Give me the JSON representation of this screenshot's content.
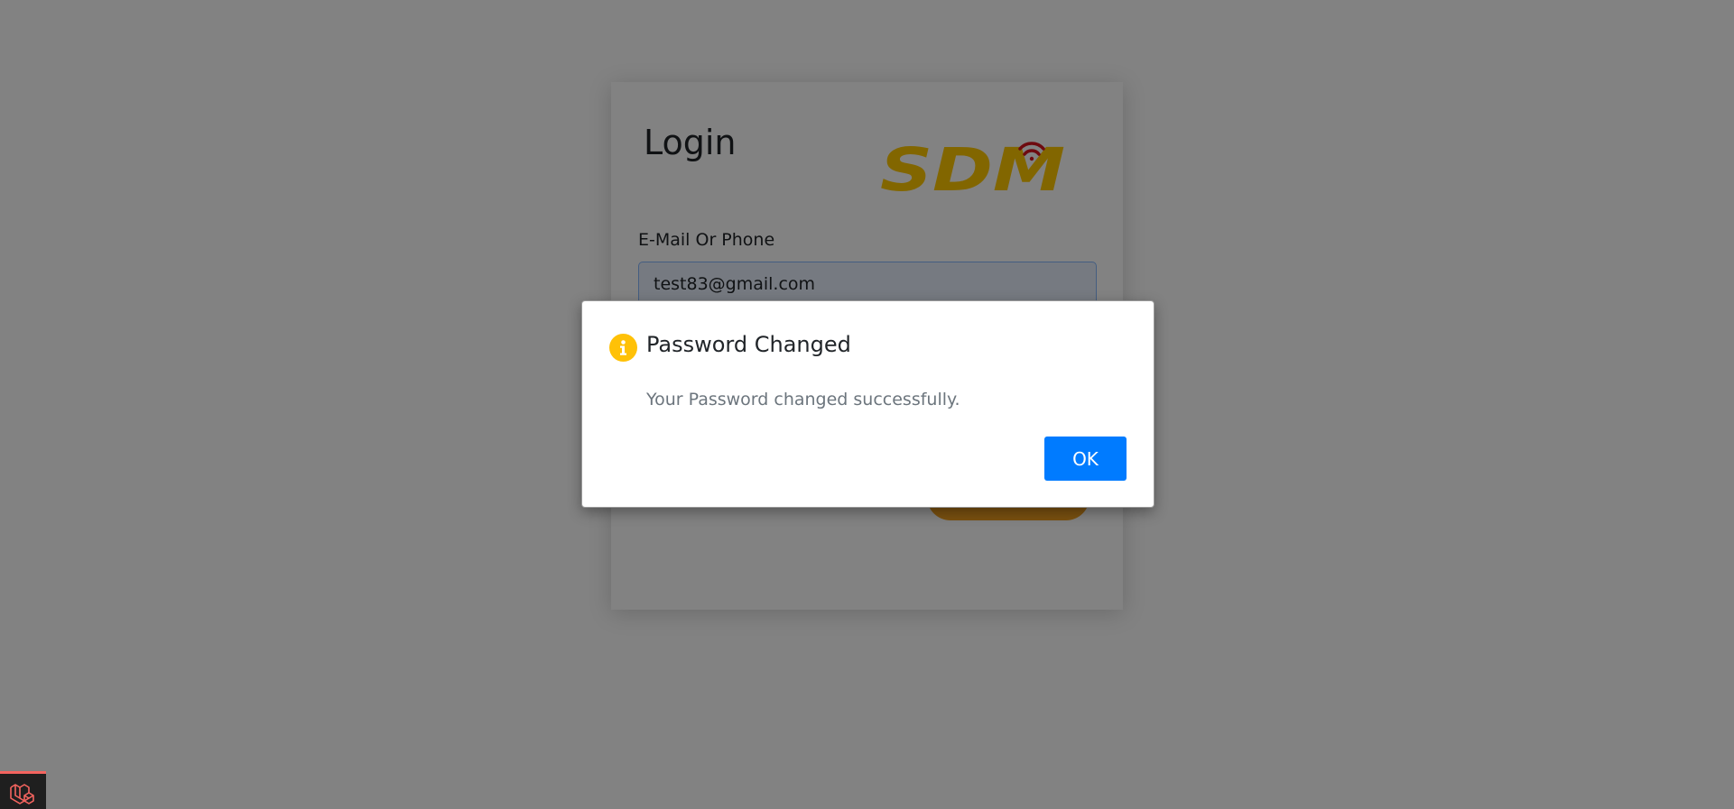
{
  "login": {
    "title": "Login",
    "logo_text": "SDM",
    "email_label": "E-Mail Or Phone",
    "email_value": "test83@gmail.com"
  },
  "dialog": {
    "icon": "info-icon",
    "title": "Password Changed",
    "message": "Your Password changed successfully.",
    "ok_label": "OK"
  },
  "debugbar": {
    "icon": "laravel-icon"
  },
  "colors": {
    "logo_red": "#d7141e",
    "logo_yellow": "#ffc800",
    "info_icon": "#ffc107",
    "ok_button": "#007bff",
    "login_button": "#f0a020",
    "debugbar_accent": "#f4645f"
  }
}
